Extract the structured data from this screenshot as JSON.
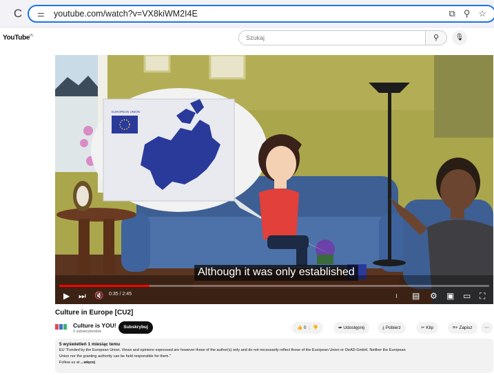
{
  "browser": {
    "reload_icon": "reload-icon",
    "url": "youtube.com/watch?v=VX8kiWM2I4E"
  },
  "header": {
    "logo": "YouTube",
    "logo_suffix": "PL",
    "search_placeholder": "Szukaj"
  },
  "player": {
    "caption": "Although it was only established",
    "time": "0:35 / 2:45",
    "progress": 0.21,
    "map_label": "EUROPEAN UNION"
  },
  "video": {
    "title": "Culture in Europe [CU2]",
    "channel_name": "Culture is YOU!",
    "subscribers": "2 subskrybentów",
    "subscribe_label": "Subskrybuj",
    "like_count": "0",
    "share_label": "Udostępnij",
    "download_label": "Pobierz",
    "clip_label": "Klip",
    "save_label": "Zapisz"
  },
  "description": {
    "meta": "5 wyświetleń  1 miesiąc temu",
    "line1": "EU \"Funded by the European Union. Views and opinions expressed are however those of the author(s) only and do not necessarily reflect those of the European Union or OeAD-GmbH. Neither the European",
    "line2": "Union nor the granting authority can be held responsible for them.\"",
    "line3": "Follow us at",
    "more": "...więcej"
  },
  "colors": {
    "accent": "#1a73e8",
    "youtube_red": "#ff0000",
    "eu_blue": "#2a3a9b",
    "wall": "#aaa64c"
  }
}
